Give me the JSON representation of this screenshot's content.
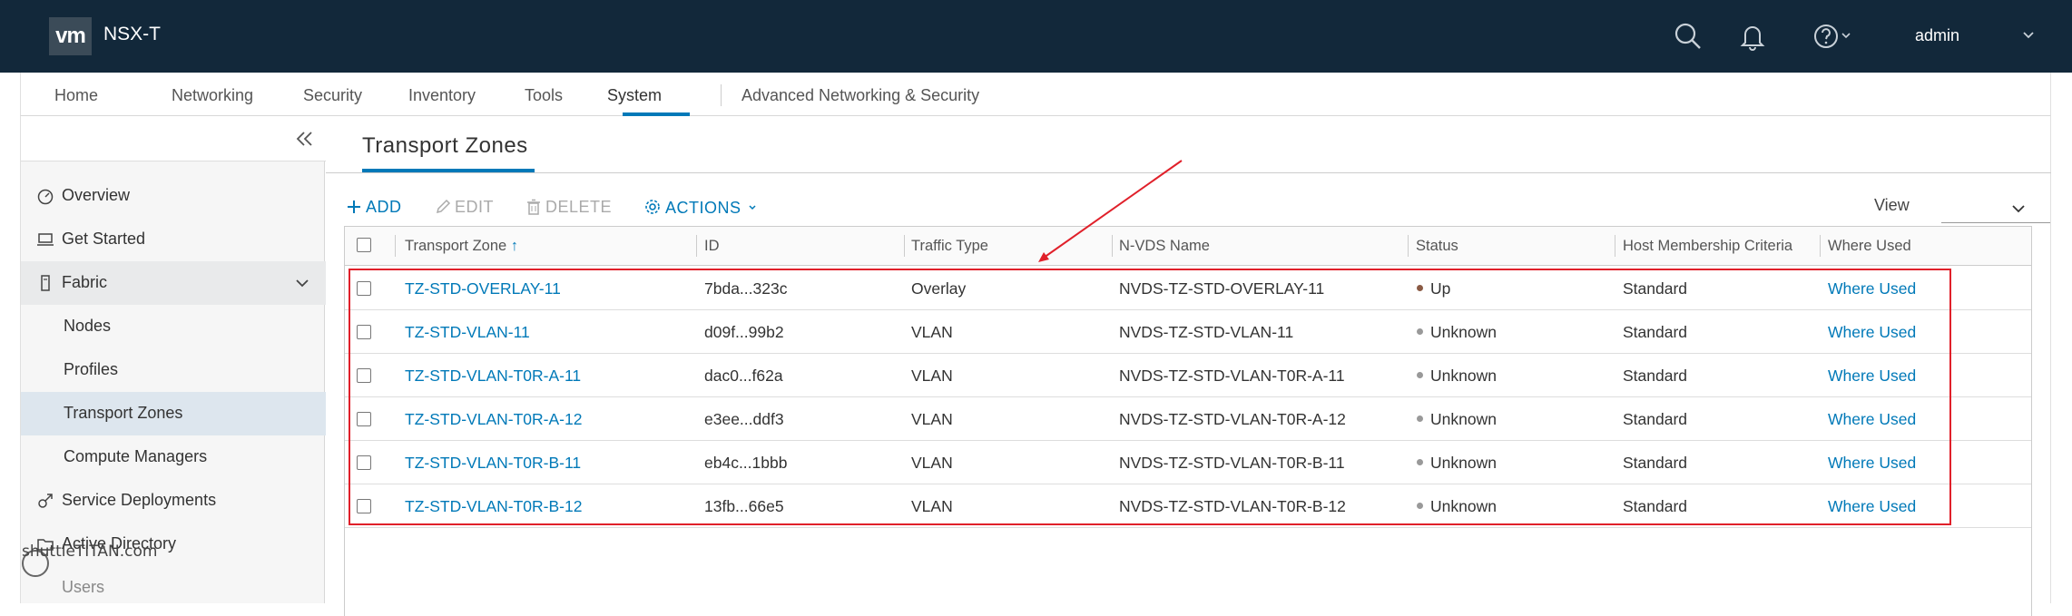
{
  "topbar": {
    "logo": "vm",
    "title": "NSX-T",
    "user": "admin",
    "background": "#12283a",
    "icons": [
      "search-icon",
      "bell-icon",
      "help-icon",
      "chevron-down-icon"
    ]
  },
  "main_nav": {
    "items": [
      {
        "label": "Home"
      },
      {
        "label": "Networking"
      },
      {
        "label": "Security"
      },
      {
        "label": "Inventory"
      },
      {
        "label": "Tools"
      },
      {
        "label": "System",
        "active": true
      },
      {
        "label": "Advanced Networking & Security"
      }
    ],
    "accent": "#0079b8"
  },
  "sidebar": {
    "items": [
      {
        "label": "Overview",
        "icon": "dashboard-gauge-icon"
      },
      {
        "label": "Get Started",
        "icon": "laptop-icon"
      },
      {
        "label": "Fabric",
        "icon": "server-icon",
        "expanded": true
      },
      {
        "label": "Nodes"
      },
      {
        "label": "Profiles"
      },
      {
        "label": "Transport Zones",
        "selected": true
      },
      {
        "label": "Compute Managers"
      },
      {
        "label": "Service Deployments",
        "icon": "external-link-icon"
      },
      {
        "label": "Active Directory",
        "icon": "folder-icon"
      },
      {
        "label": "Users"
      }
    ]
  },
  "page": {
    "title": "Transport Zones"
  },
  "toolbar": {
    "add": "ADD",
    "edit": "EDIT",
    "delete": "DELETE",
    "actions": "ACTIONS",
    "view_label": "View"
  },
  "table": {
    "columns": [
      "Transport Zone",
      "ID",
      "Traffic Type",
      "N-VDS Name",
      "Status",
      "Host Membership Criteria",
      "Where Used"
    ],
    "sort_indicator": "↑",
    "rows": [
      {
        "zone": "TZ-STD-OVERLAY-11",
        "id": "7bda...323c",
        "traffic": "Overlay",
        "nvds": "NVDS-TZ-STD-OVERLAY-11",
        "status": "Up",
        "status_color": "#8a5a44",
        "criteria": "Standard",
        "where_used": "Where Used"
      },
      {
        "zone": "TZ-STD-VLAN-11",
        "id": "d09f...99b2",
        "traffic": "VLAN",
        "nvds": "NVDS-TZ-STD-VLAN-11",
        "status": "Unknown",
        "status_color": "#999999",
        "criteria": "Standard",
        "where_used": "Where Used"
      },
      {
        "zone": "TZ-STD-VLAN-T0R-A-11",
        "id": "dac0...f62a",
        "traffic": "VLAN",
        "nvds": "NVDS-TZ-STD-VLAN-T0R-A-11",
        "status": "Unknown",
        "status_color": "#999999",
        "criteria": "Standard",
        "where_used": "Where Used"
      },
      {
        "zone": "TZ-STD-VLAN-T0R-A-12",
        "id": "e3ee...ddf3",
        "traffic": "VLAN",
        "nvds": "NVDS-TZ-STD-VLAN-T0R-A-12",
        "status": "Unknown",
        "status_color": "#999999",
        "criteria": "Standard",
        "where_used": "Where Used"
      },
      {
        "zone": "TZ-STD-VLAN-T0R-B-11",
        "id": "eb4c...1bbb",
        "traffic": "VLAN",
        "nvds": "NVDS-TZ-STD-VLAN-T0R-B-11",
        "status": "Unknown",
        "status_color": "#999999",
        "criteria": "Standard",
        "where_used": "Where Used"
      },
      {
        "zone": "TZ-STD-VLAN-T0R-B-12",
        "id": "13fb...66e5",
        "traffic": "VLAN",
        "nvds": "NVDS-TZ-STD-VLAN-T0R-B-12",
        "status": "Unknown",
        "status_color": "#999999",
        "criteria": "Standard",
        "where_used": "Where Used"
      }
    ]
  },
  "annotation_color": "#e0202a",
  "watermark": "shuttleTITAN.com"
}
